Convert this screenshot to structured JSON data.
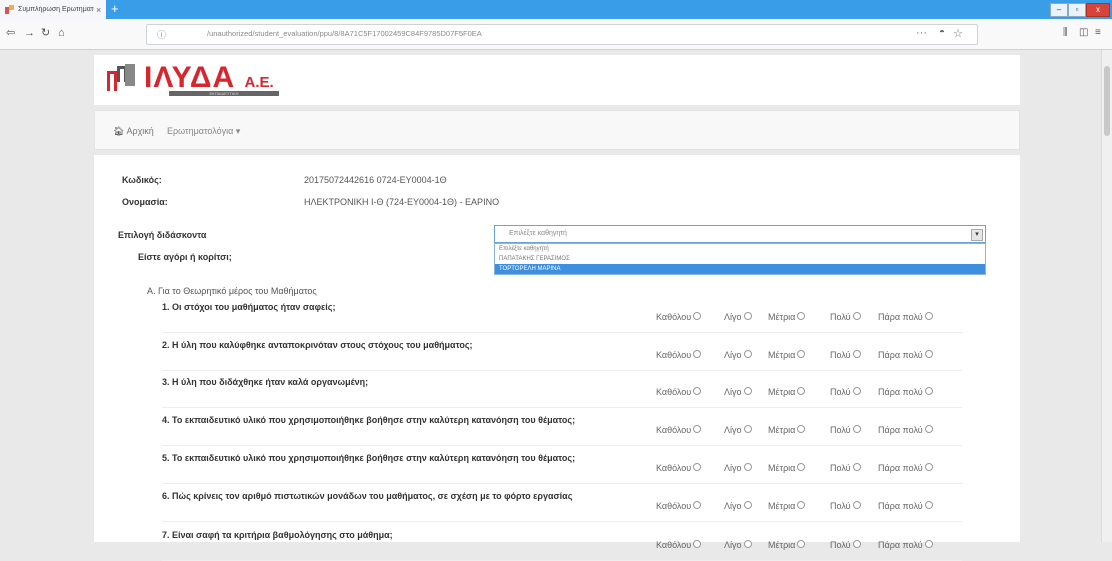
{
  "browser": {
    "tab_title": "Συμπλήρωση Ερωτηματολογ",
    "tab_close": "×",
    "new_tab": "+",
    "url": "/unauthorized/student_evaluation/ppu/8/8A71C5F17002459C84F9785D07F5F0EA",
    "url_info": "ⓘ",
    "url_more": "···",
    "window_min": "–",
    "window_max": "▫",
    "window_close": "x"
  },
  "brand": {
    "name": "ΙΛΥΔΑ",
    "suffix": "Α.Ε.",
    "tagline": "ΕΚΠΑΙΔΕΥΤΙΚΗ",
    "color": "#d7262e"
  },
  "menu": {
    "home": "Αρχική",
    "questionnaires": "Ερωτηματολόγια ▾"
  },
  "course": {
    "code_label": "Κωδικός:",
    "code_value": "20175072442616 0724-ΕΥ0004-1Θ",
    "name_label": "Ονομασία:",
    "name_value": "ΗΛΕΚΤΡΟΝΙΚΗ Ι-Θ (724-ΕΥ0004-1Θ) - ΕΑΡΙΝΟ"
  },
  "teacher": {
    "label": "Επιλογή διδάσκοντα",
    "placeholder": "Επιλέξτε καθηγητή",
    "options": [
      "Επιλέξτε καθηγητή",
      "ΠΑΠΑΤΑΚΗΣ ΓΕΡΑΣΙΜΟΣ",
      "ΤΟΡΤΟΡΕΛΗ ΜΑΡΙΝΑ"
    ],
    "selected_index": 2
  },
  "gender_question": "Είστε αγόρι ή κορίτσι;",
  "section_title": "Α. Για το Θεωρητικό μέρος του Μαθήματος",
  "scale": [
    "Καθόλου",
    "Λίγο",
    "Μέτρια",
    "Πολύ",
    "Πάρα πολύ"
  ],
  "questions": [
    "1. Οι στόχοι του μαθήματος ήταν σαφείς;",
    "2. Η ύλη που καλύφθηκε ανταποκρινόταν στους στόχους του μαθήματος;",
    "3. Η ύλη που διδάχθηκε ήταν καλά οργανωμένη;",
    "4. Το εκπαιδευτικό υλικό που χρησιμοποιήθηκε βοήθησε στην καλύτερη κατανόηση του θέματος;",
    "5. Το εκπαιδευτικό υλικό που χρησιμοποιήθηκε βοήθησε στην καλύτερη κατανόηση του θέματος;",
    "6. Πώς κρίνεις τον αριθμό πιστωτικών μονάδων του μαθήματος, σε σχέση με το φόρτο εργασίας",
    "7. Είναι σαφή τα κριτήρια βαθμολόγησης στο μάθημα;"
  ]
}
